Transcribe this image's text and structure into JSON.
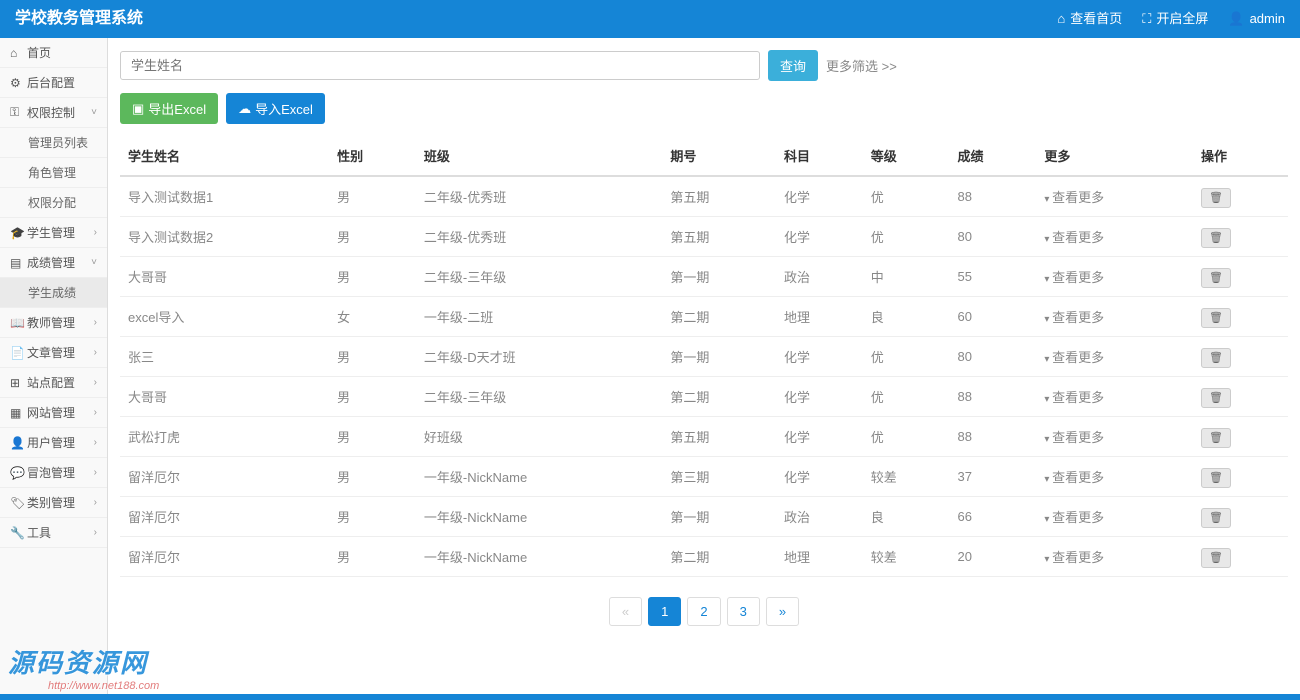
{
  "header": {
    "title": "学校教务管理系统",
    "home": "查看首页",
    "fullscreen": "开启全屏",
    "user": "admin"
  },
  "sidebar": {
    "items": [
      {
        "icon": "home",
        "label": "首页",
        "hasSub": false
      },
      {
        "icon": "gear",
        "label": "后台配置",
        "hasSub": false
      },
      {
        "icon": "key",
        "label": "权限控制",
        "hasSub": true,
        "open": true,
        "subs": [
          "管理员列表",
          "角色管理",
          "权限分配"
        ]
      },
      {
        "icon": "grad",
        "label": "学生管理",
        "hasSub": true
      },
      {
        "icon": "chart",
        "label": "成绩管理",
        "hasSub": true,
        "open": true,
        "subs": [
          "学生成绩"
        ],
        "activeSub": 0
      },
      {
        "icon": "book",
        "label": "教师管理",
        "hasSub": true
      },
      {
        "icon": "file",
        "label": "文章管理",
        "hasSub": true
      },
      {
        "icon": "site",
        "label": "站点配置",
        "hasSub": true
      },
      {
        "icon": "web",
        "label": "网站管理",
        "hasSub": true
      },
      {
        "icon": "user",
        "label": "用户管理",
        "hasSub": true
      },
      {
        "icon": "msg",
        "label": "冒泡管理",
        "hasSub": true
      },
      {
        "icon": "tag",
        "label": "类别管理",
        "hasSub": true
      },
      {
        "icon": "tool",
        "label": "工具",
        "hasSub": true
      }
    ]
  },
  "search": {
    "placeholder": "学生姓名",
    "query": "查询",
    "more": "更多筛选 >>"
  },
  "buttons": {
    "export": "导出Excel",
    "import": "导入Excel"
  },
  "table": {
    "headers": [
      "学生姓名",
      "性别",
      "班级",
      "期号",
      "科目",
      "等级",
      "成绩",
      "更多",
      "操作"
    ],
    "moreLabel": "查看更多",
    "rows": [
      {
        "name": "导入测试数据1",
        "gender": "男",
        "class": "二年级-优秀班",
        "term": "第五期",
        "subject": "化学",
        "grade": "优",
        "score": "88"
      },
      {
        "name": "导入测试数据2",
        "gender": "男",
        "class": "二年级-优秀班",
        "term": "第五期",
        "subject": "化学",
        "grade": "优",
        "score": "80"
      },
      {
        "name": "大哥哥",
        "gender": "男",
        "class": "二年级-三年级",
        "term": "第一期",
        "subject": "政治",
        "grade": "中",
        "score": "55"
      },
      {
        "name": "excel导入",
        "gender": "女",
        "class": "一年级-二班",
        "term": "第二期",
        "subject": "地理",
        "grade": "良",
        "score": "60"
      },
      {
        "name": "张三",
        "gender": "男",
        "class": "二年级-D天才班",
        "term": "第一期",
        "subject": "化学",
        "grade": "优",
        "score": "80"
      },
      {
        "name": "大哥哥",
        "gender": "男",
        "class": "二年级-三年级",
        "term": "第二期",
        "subject": "化学",
        "grade": "优",
        "score": "88"
      },
      {
        "name": "武松打虎",
        "gender": "男",
        "class": "好班级",
        "term": "第五期",
        "subject": "化学",
        "grade": "优",
        "score": "88"
      },
      {
        "name": "留洋厄尔",
        "gender": "男",
        "class": "一年级-NickName",
        "term": "第三期",
        "subject": "化学",
        "grade": "较差",
        "score": "37"
      },
      {
        "name": "留洋厄尔",
        "gender": "男",
        "class": "一年级-NickName",
        "term": "第一期",
        "subject": "政治",
        "grade": "良",
        "score": "66"
      },
      {
        "name": "留洋厄尔",
        "gender": "男",
        "class": "一年级-NickName",
        "term": "第二期",
        "subject": "地理",
        "grade": "较差",
        "score": "20"
      }
    ]
  },
  "pagination": {
    "pages": [
      "«",
      "1",
      "2",
      "3",
      "»"
    ],
    "active": 1
  },
  "watermark": {
    "text": "源码资源网",
    "url": "http://www.net188.com"
  },
  "icons": {
    "home": "⌂",
    "gear": "⚙",
    "key": "⚿",
    "grad": "🎓",
    "chart": "▤",
    "book": "📖",
    "file": "📄",
    "site": "⊞",
    "web": "▦",
    "user": "👤",
    "msg": "💬",
    "tag": "🏷",
    "tool": "🔧"
  }
}
